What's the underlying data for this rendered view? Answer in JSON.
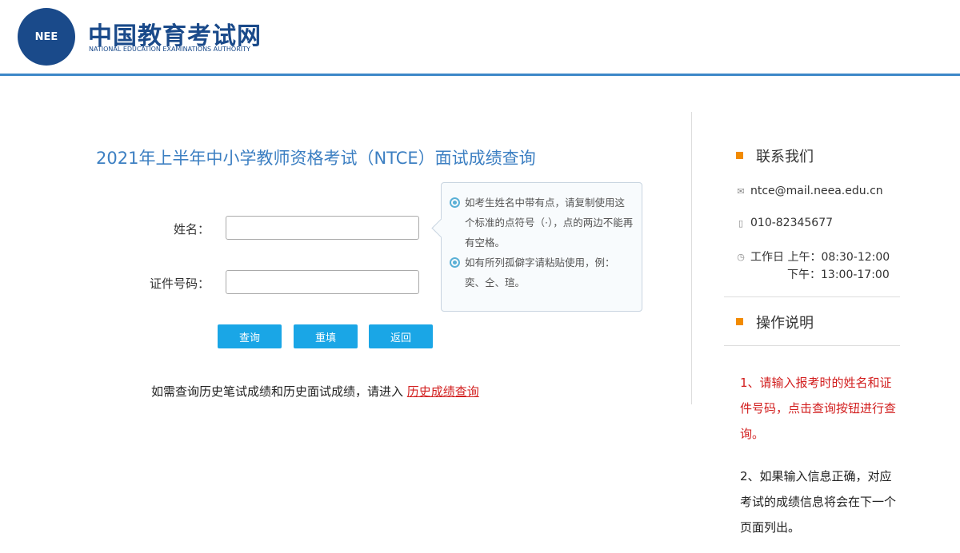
{
  "header": {
    "logo_badge": "NEE",
    "logo_cn": "中国教育考试网",
    "logo_en": "NATIONAL EDUCATION EXAMINATIONS AUTHORITY"
  },
  "form": {
    "title": "2021年上半年中小学教师资格考试（NTCE）面试成绩查询",
    "name_label": "姓名：",
    "id_label": "证件号码：",
    "name_value": "",
    "id_value": "",
    "buttons": {
      "query": "查询",
      "reset": "重填",
      "back": "返回"
    }
  },
  "tips": [
    "如考生姓名中带有点，请复制使用这个标准的点符号（·），点的两边不能再有空格。",
    "如有所列孤僻字请粘贴使用，例：奕、仝、瑄。"
  ],
  "history": {
    "text": "如需查询历史笔试成绩和历史面试成绩，请进入",
    "link": "历史成绩查询"
  },
  "sidebar": {
    "contact_title": "联系我们",
    "email": "ntce@mail.neea.edu.cn",
    "phone": "010-82345677",
    "hours_am": "工作日 上午：08:30-12:00",
    "hours_pm": "下午：13:00-17:00",
    "instr_title": "操作说明",
    "note1": "1、请输入报考时的姓名和证件号码，点击查询按钮进行查询。",
    "note2": "2、如果输入信息正确，对应考试的成绩信息将会在下一个页面列出。"
  },
  "colors": {
    "accent": "#3c87c8",
    "button": "#1aa6e6",
    "red": "#d21e1e",
    "orange": "#f28b00"
  }
}
